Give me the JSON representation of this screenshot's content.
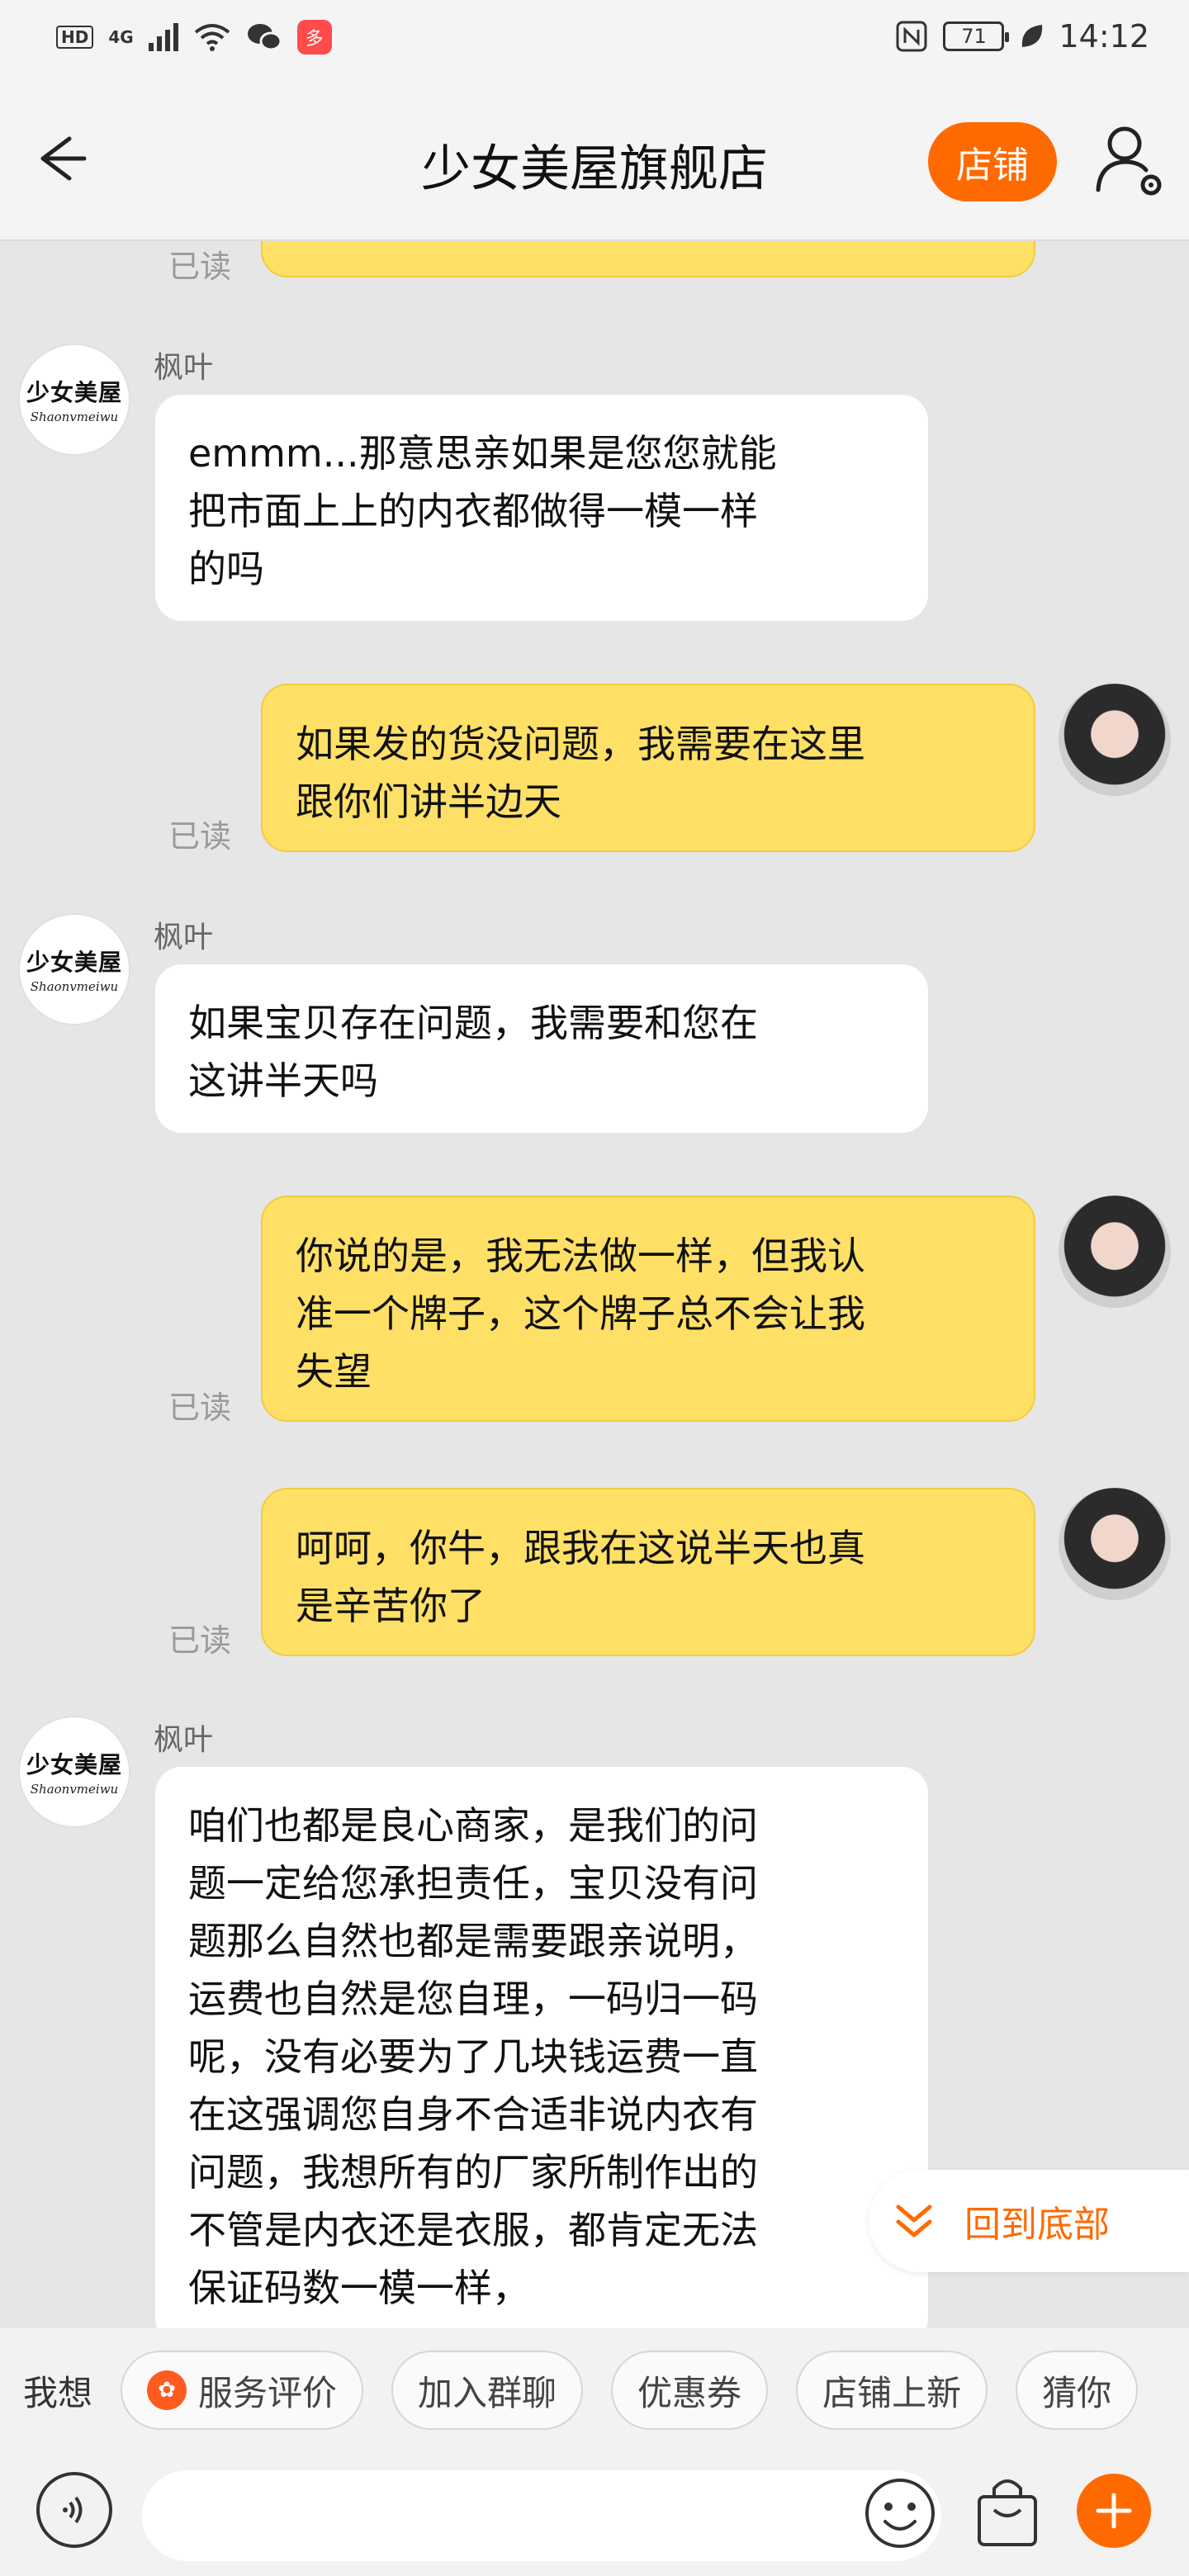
{
  "status_bar": {
    "hd": "HD",
    "network": "4G",
    "battery": "71",
    "time": "14:12",
    "app_icon_text": "多"
  },
  "header": {
    "title": "少女美屋旗舰店",
    "shop_button": "店铺",
    "back_icon": "arrow-left-icon",
    "user_settings_icon": "user-settings-icon"
  },
  "shop_avatar": {
    "logo_cn": "少女美屋",
    "logo_en": "Shaonvmeiwu"
  },
  "messages": [
    {
      "from": "user",
      "text": "",
      "read": "已读"
    },
    {
      "from": "shop",
      "sender": "枫叶",
      "text": "emmm...那意思亲如果是您您就能\n把市面上上的内衣都做得一模一样\n的吗"
    },
    {
      "from": "user",
      "text": "如果发的货没问题，我需要在这里\n跟你们讲半边天",
      "read": "已读"
    },
    {
      "from": "shop",
      "sender": "枫叶",
      "text": "如果宝贝存在问题，我需要和您在\n这讲半天吗"
    },
    {
      "from": "user",
      "text": "你说的是，我无法做一样，但我认\n准一个牌子，这个牌子总不会让我\n失望",
      "read": "已读"
    },
    {
      "from": "user",
      "text": "呵呵，你牛，跟我在这说半天也真\n是辛苦你了",
      "read": "已读"
    },
    {
      "from": "shop",
      "sender": "枫叶",
      "text": "咱们也都是良心商家，是我们的问\n题一定给您承担责任，宝贝没有问\n题那么自然也都是需要跟亲说明，\n运费也自然是您自理，一码归一码\n呢，没有必要为了几块钱运费一直\n在这强调您自身不合适非说内衣有\n问题，我想所有的厂家所制作出的\n不管是内衣还是衣服，都肯定无法\n保证码数一模一样，"
    }
  ],
  "scroll_to_bottom": {
    "label": "回到底部",
    "icon": "chevrons-down-icon"
  },
  "quick_bar": {
    "label": "我想",
    "chips": [
      "服务评价",
      "加入群聊",
      "优惠券",
      "店铺上新",
      "猜你"
    ]
  },
  "input_bar": {
    "placeholder": "",
    "icons": [
      "voice-icon",
      "emoji-icon",
      "shopping-bag-icon",
      "plus-icon"
    ]
  },
  "colors": {
    "accent": "#ff6a00",
    "user_bubble": "#ffe066",
    "background": "#e6e6e6"
  }
}
